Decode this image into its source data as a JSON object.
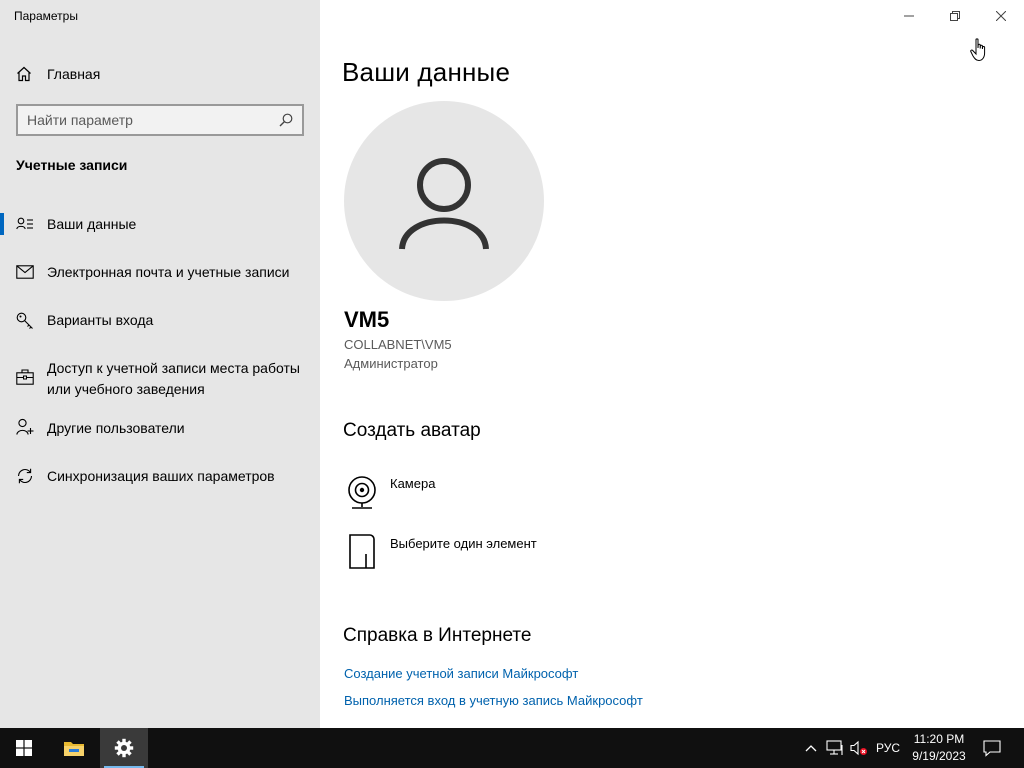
{
  "window": {
    "title": "Параметры",
    "controls": [
      "minimize-icon",
      "restore-icon",
      "close-icon"
    ]
  },
  "sidebar": {
    "home_label": "Главная",
    "search_placeholder": "Найти параметр",
    "section_title": "Учетные записи",
    "items": [
      {
        "label": "Ваши данные",
        "icon": "user-card-icon",
        "active": true
      },
      {
        "label": "Электронная почта и учетные записи",
        "icon": "mail-icon",
        "active": false
      },
      {
        "label": "Варианты входа",
        "icon": "key-icon",
        "active": false
      },
      {
        "label": "Доступ к учетной записи места работы или учебного заведения",
        "icon": "briefcase-icon",
        "active": false
      },
      {
        "label": "Другие пользователи",
        "icon": "add-user-icon",
        "active": false
      },
      {
        "label": "Синхронизация ваших параметров",
        "icon": "sync-icon",
        "active": false
      }
    ]
  },
  "main": {
    "page_title": "Ваши данные",
    "user": {
      "name": "VM5",
      "domain_account": "COLLABNET\\VM5",
      "role": "Администратор"
    },
    "avatar_section": {
      "title": "Создать аватар",
      "options": [
        {
          "label": "Камера",
          "icon": "camera-icon"
        },
        {
          "label": "Выберите один элемент",
          "icon": "file-icon"
        }
      ]
    },
    "help_section": {
      "title": "Справка в Интернете",
      "links": [
        "Создание учетной записи Майкрософт",
        "Выполняется вход в учетную запись Майкрософт"
      ]
    }
  },
  "taskbar": {
    "apps": [
      "start-icon",
      "file-explorer-icon",
      "settings-icon"
    ],
    "tray": {
      "language": "РУС",
      "time": "11:20 PM",
      "date": "9/19/2023"
    }
  },
  "colors": {
    "accent": "#0067c0",
    "link": "#0062ad",
    "sidebar_bg": "#e6e6e6",
    "taskbar_bg": "#101010"
  }
}
